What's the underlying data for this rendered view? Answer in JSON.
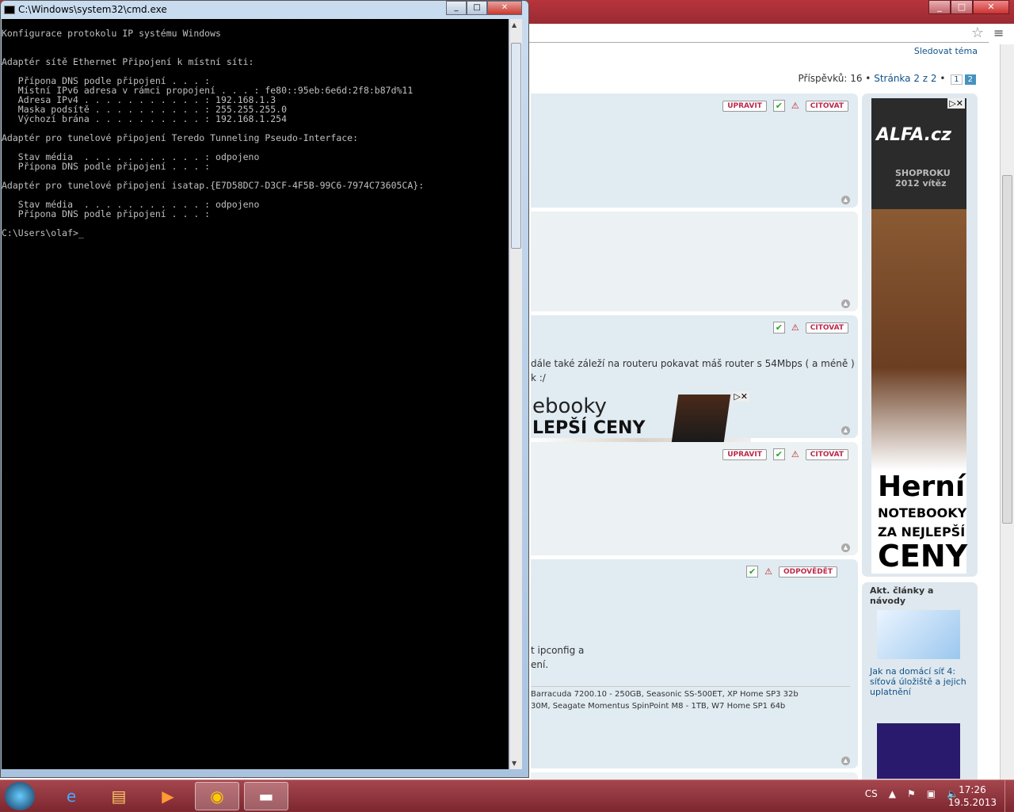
{
  "cmd": {
    "title": "C:\\Windows\\system32\\cmd.exe",
    "lines": [
      "Konfigurace protokolu IP systému Windows",
      "",
      "",
      "Adaptér sítě Ethernet Připojení k místní síti:",
      "",
      "   Přípona DNS podle připojení . . . :",
      "   Místní IPv6 adresa v rámci propojení . . . : fe80::95eb:6e6d:2f8:b87d%11",
      "   Adresa IPv4 . . . . . . . . . . . : 192.168.1.3",
      "   Maska podsítě . . . . . . . . . . : 255.255.255.0",
      "   Výchozí brána . . . . . . . . . . : 192.168.1.254",
      "",
      "Adaptér pro tunelové připojení Teredo Tunneling Pseudo-Interface:",
      "",
      "   Stav média  . . . . . . . . . . . : odpojeno",
      "   Přípona DNS podle připojení . . . :",
      "",
      "Adaptér pro tunelové připojení isatap.{E7D58DC7-D3CF-4F5B-99C6-7974C73605CA}:",
      "",
      "   Stav média  . . . . . . . . . . . : odpojeno",
      "   Přípona DNS podle připojení . . . :",
      "",
      "C:\\Users\\olaf>_"
    ]
  },
  "browser": {
    "follow": "Sledovat téma",
    "posts_label": "Příspěvků: 16",
    "page_label": "Stránka 2 z 2",
    "pages": [
      "1",
      "2"
    ],
    "edit": "UPRAVIT",
    "quote": "CITOVAT",
    "reply": "ODPOVĚDĚT",
    "post2_text": [
      "dále také záleží na routeru pokavat máš router s 54Mbps ( a méně )",
      "k :/"
    ],
    "post4_text": [
      "t ipconfig a",
      "ení."
    ],
    "sig": [
      "Barracuda 7200.10 - 250GB, Seasonic SS-500ET, XP Home SP3 32b",
      "30M, Seagate Momentus SpinPoint M8 - 1TB, W7 Home SP1 64b"
    ],
    "ad_banner": [
      "ebooky",
      "LEPŠÍ CENY"
    ],
    "side_ad": {
      "logo": "ALFA.cz",
      "shop": "SHOPROKU 2012 vítěz",
      "t1": "Herní",
      "t2": "NOTEBOOKY ZA NEJLEPŠÍ",
      "t3": "CENY"
    },
    "articles_title": "Akt. články a návody",
    "article1": "Jak na domácí síť 4: síťová úložiště a jejich uplatnění"
  },
  "taskbar": {
    "lang": "CS",
    "time": "17:26",
    "date": "19.5.2013"
  }
}
